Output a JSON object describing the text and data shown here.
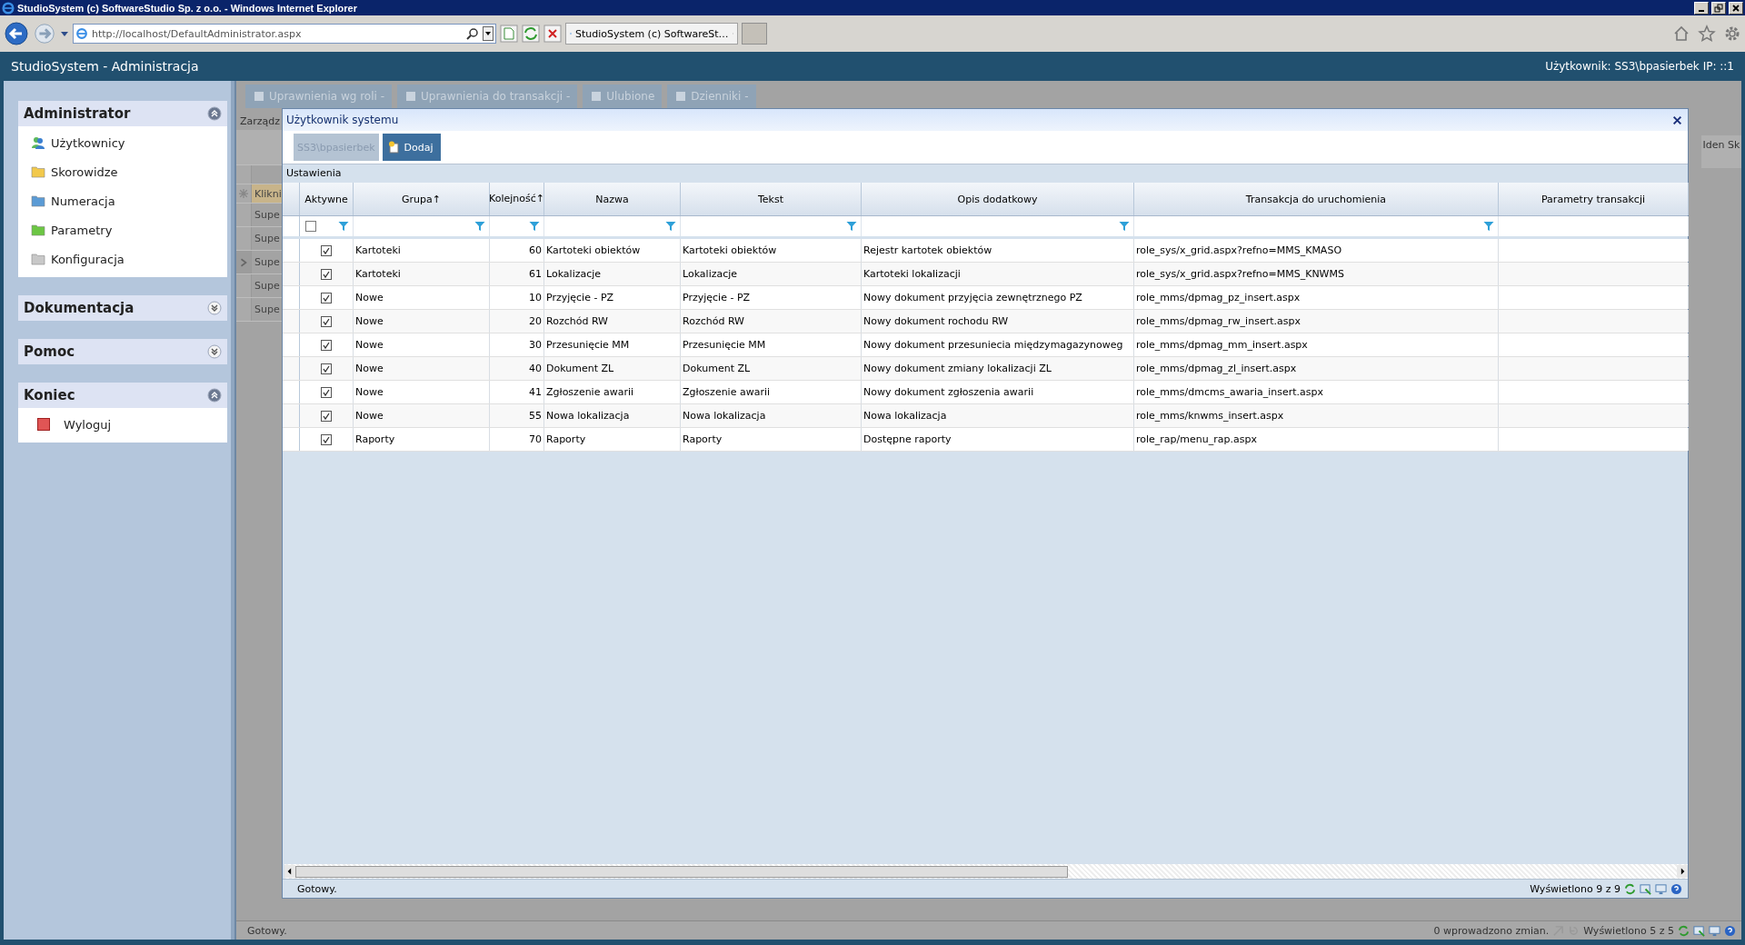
{
  "browser": {
    "title": "StudioSystem (c) SoftwareStudio Sp. z o.o. - Windows Internet Explorer",
    "address": "http://localhost/DefaultAdministrator.aspx",
    "tab": "StudioSystem (c) SoftwareSt…"
  },
  "app": {
    "title": "StudioSystem - Administracja",
    "user_info": "Użytkownik: SS3\\bpasierbek IP: ::1"
  },
  "sidebar": [
    {
      "title": "Administrator",
      "expanded": true,
      "items": [
        {
          "label": "Użytkownicy",
          "kind": "users"
        },
        {
          "label": "Skorowidze",
          "kind": "folder",
          "color": "#f2c94c"
        },
        {
          "label": "Numeracja",
          "kind": "folder",
          "color": "#5b9bd5"
        },
        {
          "label": "Parametry",
          "kind": "folder",
          "color": "#6cc644"
        },
        {
          "label": "Konfiguracja",
          "kind": "folder",
          "color": "#c8c8c8"
        }
      ]
    },
    {
      "title": "Dokumentacja",
      "expanded": false
    },
    {
      "title": "Pomoc",
      "expanded": false
    },
    {
      "title": "Koniec",
      "expanded": true,
      "items": [
        {
          "label": "Wyloguj",
          "kind": "logout"
        }
      ]
    }
  ],
  "background": {
    "tabs": [
      "Uprawnienia wg roli -",
      "Uprawnienia do transakcji -",
      "Ulubione",
      "Dzienniki -"
    ],
    "caption": "Zarządz",
    "new_row": "Klikni",
    "rows": [
      {
        "text": "Supe",
        "current": false
      },
      {
        "text": "Supe",
        "current": false
      },
      {
        "text": "Supe",
        "current": true
      },
      {
        "text": "Supe",
        "current": false
      },
      {
        "text": "Supe",
        "current": false
      }
    ],
    "right_header": "Iden Sk",
    "status": "Gotowy.",
    "changes": "0 wprowadzono zmian.",
    "count": "Wyświetlono 5 z 5"
  },
  "dialog": {
    "title": "Użytkownik systemu",
    "buttons": [
      {
        "label": "SS3\\bpasierbek",
        "disabled": true
      },
      {
        "label": "Dodaj",
        "disabled": false
      }
    ],
    "section": "Ustawienia",
    "filter_checked": false,
    "columns": [
      {
        "label": "Aktywne",
        "filter": true
      },
      {
        "label": "Grupa",
        "sort_mark": "↑",
        "filter": true
      },
      {
        "label": "Kolejność",
        "sort_mark": "↑",
        "filter": true
      },
      {
        "label": "Nazwa",
        "filter": true
      },
      {
        "label": "Tekst",
        "filter": true
      },
      {
        "label": "Opis dodatkowy",
        "filter": true
      },
      {
        "label": "Transakcja do uruchomienia",
        "filter": true
      },
      {
        "label": "Parametry transakcji",
        "filter": false
      }
    ],
    "rows": [
      {
        "active": true,
        "group": "Kartoteki",
        "order": "60",
        "name": "Kartoteki obiektów",
        "text": "Kartoteki obiektów",
        "description": "Rejestr kartotek obiektów",
        "transaction": "role_sys/x_grid.aspx?refno=MMS_KMASO"
      },
      {
        "active": true,
        "group": "Kartoteki",
        "order": "61",
        "name": "Lokalizacje",
        "text": "Lokalizacje",
        "description": "Kartoteki lokalizacji",
        "transaction": "role_sys/x_grid.aspx?refno=MMS_KNWMS"
      },
      {
        "active": true,
        "group": "Nowe",
        "order": "10",
        "name": "Przyjęcie - PZ",
        "text": "Przyjęcie - PZ",
        "description": "Nowy dokument przyjęcia zewnętrznego PZ",
        "transaction": "role_mms/dpmag_pz_insert.aspx"
      },
      {
        "active": true,
        "group": "Nowe",
        "order": "20",
        "name": "Rozchód RW",
        "text": "Rozchód RW",
        "description": "Nowy dokument rochodu RW",
        "transaction": "role_mms/dpmag_rw_insert.aspx"
      },
      {
        "active": true,
        "group": "Nowe",
        "order": "30",
        "name": "Przesunięcie MM",
        "text": "Przesunięcie MM",
        "description": "Nowy dokument przesuniecia międzymagazynoweg",
        "transaction": "role_mms/dpmag_mm_insert.aspx"
      },
      {
        "active": true,
        "group": "Nowe",
        "order": "40",
        "name": "Dokument ZL",
        "text": "Dokument ZL",
        "description": "Nowy dokument zmiany lokalizacji ZL",
        "transaction": "role_mms/dpmag_zl_insert.aspx"
      },
      {
        "active": true,
        "group": "Nowe",
        "order": "41",
        "name": "Zgłoszenie awarii",
        "text": "Zgłoszenie awarii",
        "description": "Nowy dokument zgłoszenia awarii",
        "transaction": "role_mms/dmcms_awaria_insert.aspx"
      },
      {
        "active": true,
        "group": "Nowe",
        "order": "55",
        "name": "Nowa lokalizacja",
        "text": "Nowa lokalizacja",
        "description": "Nowa lokalizacja",
        "transaction": "role_mms/knwms_insert.aspx"
      },
      {
        "active": true,
        "group": "Raporty",
        "order": "70",
        "name": "Raporty",
        "text": "Raporty",
        "description": "Dostępne raporty",
        "transaction": "role_rap/menu_rap.aspx"
      }
    ],
    "status": "Gotowy.",
    "count": "Wyświetlono 9 z 9"
  }
}
